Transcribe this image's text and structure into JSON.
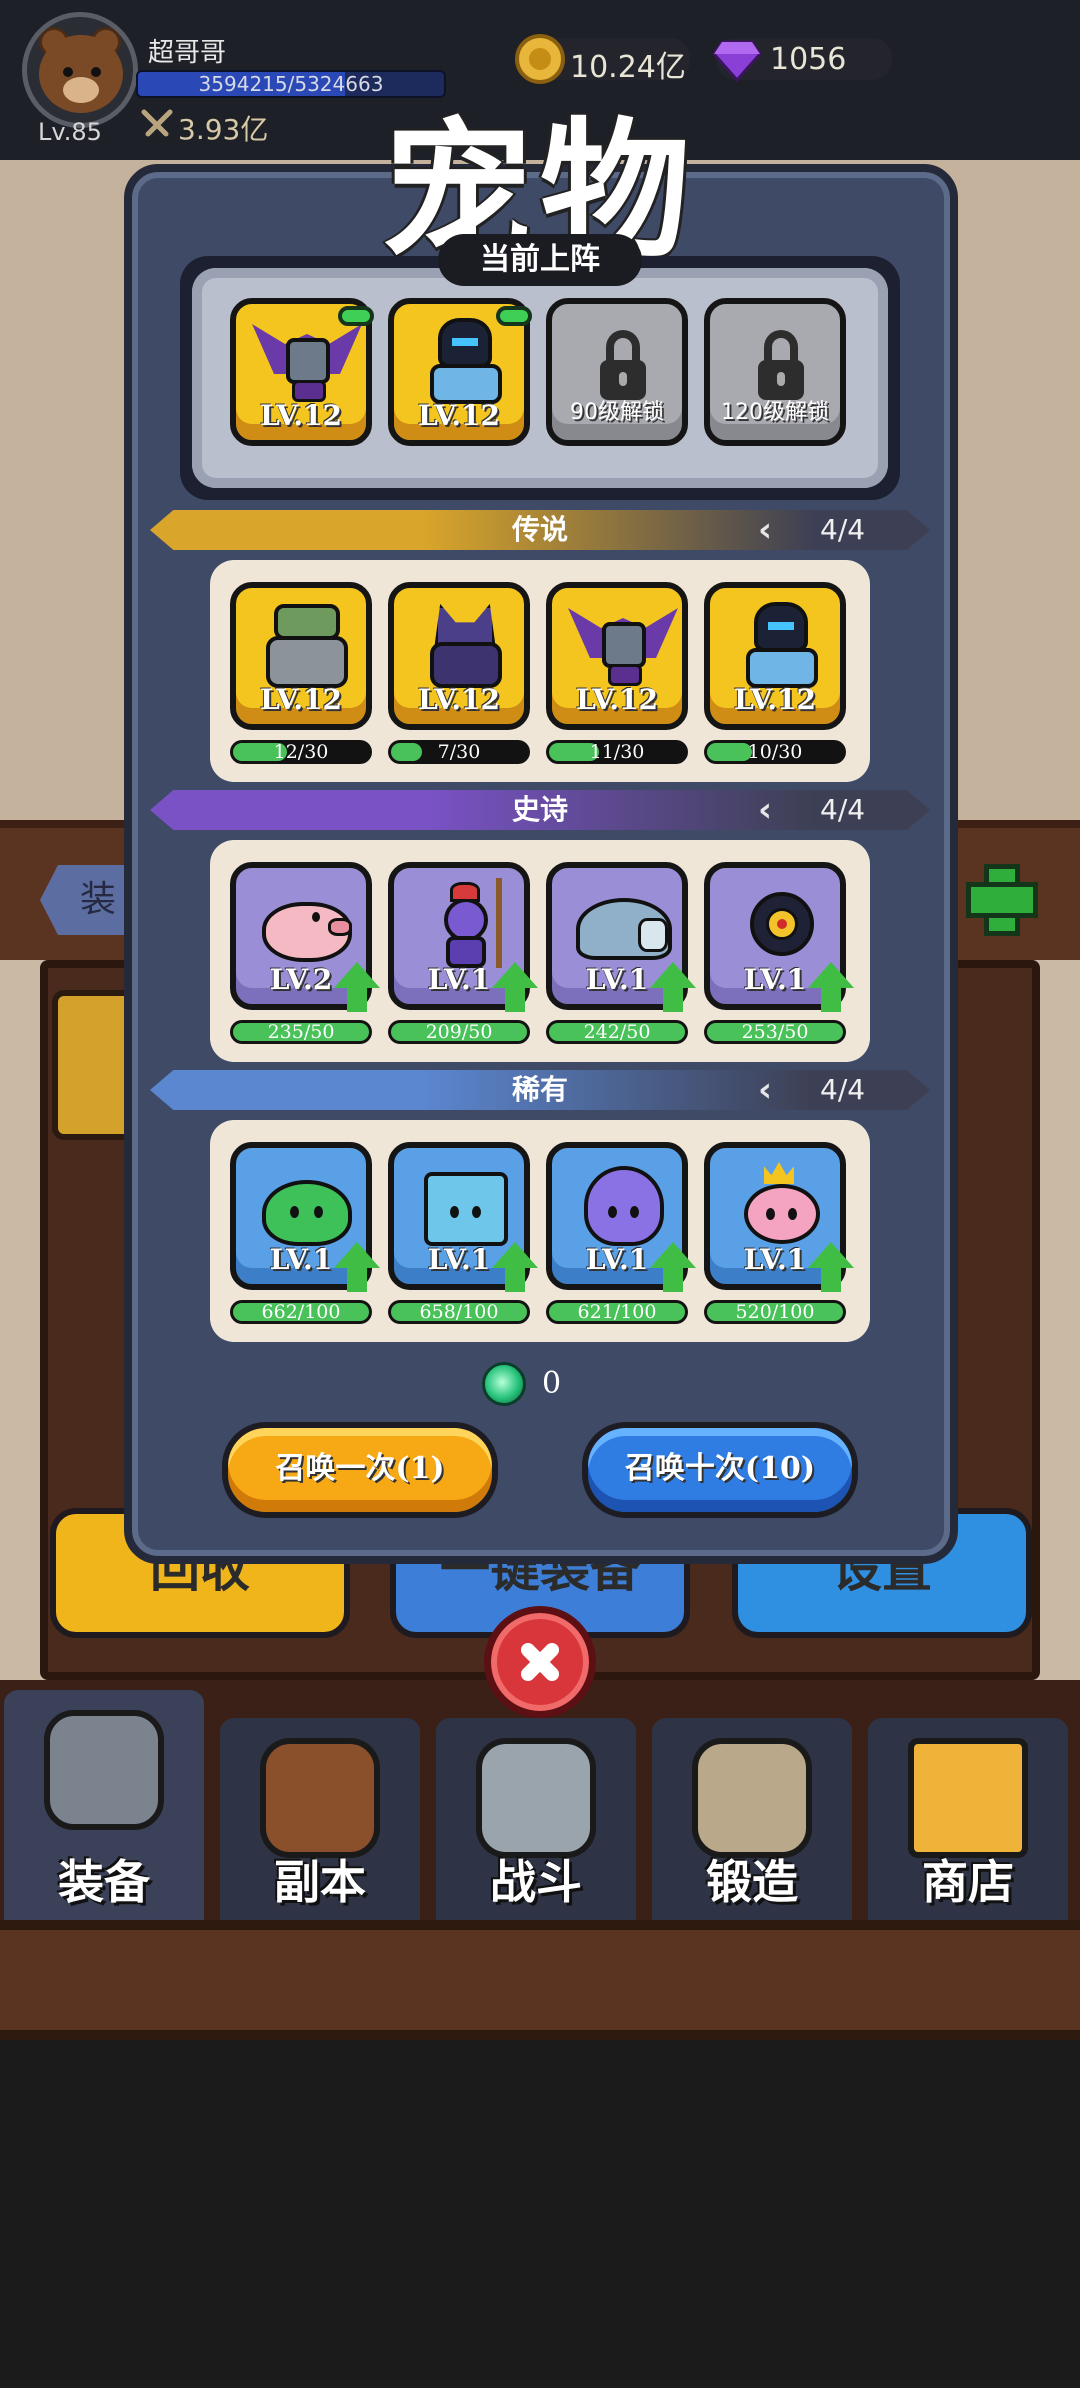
{
  "player": {
    "name": "超哥哥",
    "level": "Lv.85",
    "exp_text": "3594215/5324663",
    "exp_progress": 0.675,
    "power": "3.93亿"
  },
  "resources": {
    "gold": "10.24亿",
    "gems": "1056"
  },
  "modal": {
    "title": "宠物",
    "current_label": "当前上阵",
    "current_slots": [
      {
        "type": "pet",
        "pet": "bat-dragon",
        "level": "LV.12",
        "equipped": true
      },
      {
        "type": "pet",
        "pet": "ice-knight",
        "level": "LV.12",
        "equipped": true
      },
      {
        "type": "locked",
        "unlock_text": "90级解锁"
      },
      {
        "type": "locked",
        "unlock_text": "120级解锁"
      }
    ],
    "sections": [
      {
        "name": "传说",
        "count": "4/4",
        "color": "#d9a52a",
        "pets": [
          {
            "pet": "stone-golem",
            "level": "LV.12",
            "progress_text": "12/30",
            "progress": 0.4,
            "upgrade": false
          },
          {
            "pet": "werewolf",
            "level": "LV.12",
            "progress_text": "7/30",
            "progress": 0.23,
            "upgrade": false
          },
          {
            "pet": "bat-dragon",
            "level": "LV.12",
            "progress_text": "11/30",
            "progress": 0.37,
            "upgrade": false
          },
          {
            "pet": "ice-knight",
            "level": "LV.12",
            "progress_text": "10/30",
            "progress": 0.33,
            "upgrade": false
          }
        ]
      },
      {
        "name": "史诗",
        "count": "4/4",
        "color": "#7a52c6",
        "pets": [
          {
            "pet": "pink-pig",
            "level": "LV.2",
            "progress_text": "235/50",
            "progress": 1.0,
            "upgrade": true
          },
          {
            "pet": "purple-goblin",
            "level": "LV.1",
            "progress_text": "209/50",
            "progress": 1.0,
            "upgrade": true
          },
          {
            "pet": "rock-turtle",
            "level": "LV.1",
            "progress_text": "242/50",
            "progress": 1.0,
            "upgrade": true
          },
          {
            "pet": "eye-beast",
            "level": "LV.1",
            "progress_text": "253/50",
            "progress": 1.0,
            "upgrade": true
          }
        ]
      },
      {
        "name": "稀有",
        "count": "4/4",
        "color": "#5b86d0",
        "pets": [
          {
            "pet": "green-slime",
            "level": "LV.1",
            "progress_text": "662/100",
            "progress": 1.0,
            "upgrade": true
          },
          {
            "pet": "ice-cube",
            "level": "LV.1",
            "progress_text": "658/100",
            "progress": 1.0,
            "upgrade": true
          },
          {
            "pet": "purple-ghost",
            "level": "LV.1",
            "progress_text": "621/100",
            "progress": 1.0,
            "upgrade": true
          },
          {
            "pet": "pink-king-slime",
            "level": "LV.1",
            "progress_text": "520/100",
            "progress": 1.0,
            "upgrade": true
          }
        ]
      }
    ],
    "summon_currency": "0",
    "summon_one_label": "召唤一次(1)",
    "summon_ten_label": "召唤十次(10)"
  },
  "background": {
    "tab_label": "装",
    "buttons": [
      "回收",
      "一键装备",
      "设置"
    ]
  },
  "nav": [
    {
      "label": "装备",
      "icon": "helmet-icon",
      "active": true
    },
    {
      "label": "副本",
      "icon": "sword-shield-icon",
      "active": false
    },
    {
      "label": "战斗",
      "icon": "crossed-swords-icon",
      "active": false
    },
    {
      "label": "锻造",
      "icon": "hammer-scroll-icon",
      "active": false
    },
    {
      "label": "商店",
      "icon": "shop-icon",
      "active": false
    }
  ]
}
